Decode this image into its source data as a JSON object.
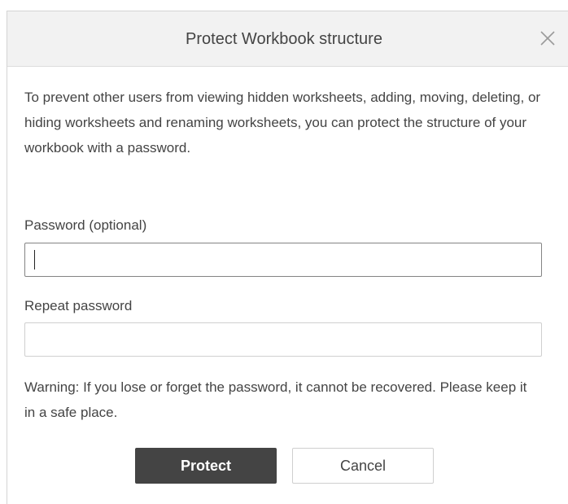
{
  "dialog": {
    "title": "Protect Workbook structure",
    "close_icon": "close-icon",
    "description": "To prevent other users from viewing hidden worksheets, adding, moving, deleting, or hiding worksheets and renaming worksheets, you can protect the structure of your workbook with a password.",
    "password": {
      "label": "Password (optional)",
      "value": ""
    },
    "repeat_password": {
      "label": "Repeat password",
      "value": ""
    },
    "warning": "Warning: If you lose or forget the password, it cannot be recovered. Please keep it in a safe place.",
    "buttons": {
      "protect": "Protect",
      "cancel": "Cancel"
    }
  },
  "colors": {
    "header_bg": "#f2f2f2",
    "primary_button_bg": "#444444",
    "text": "#444444",
    "border": "#cfcfcf"
  }
}
